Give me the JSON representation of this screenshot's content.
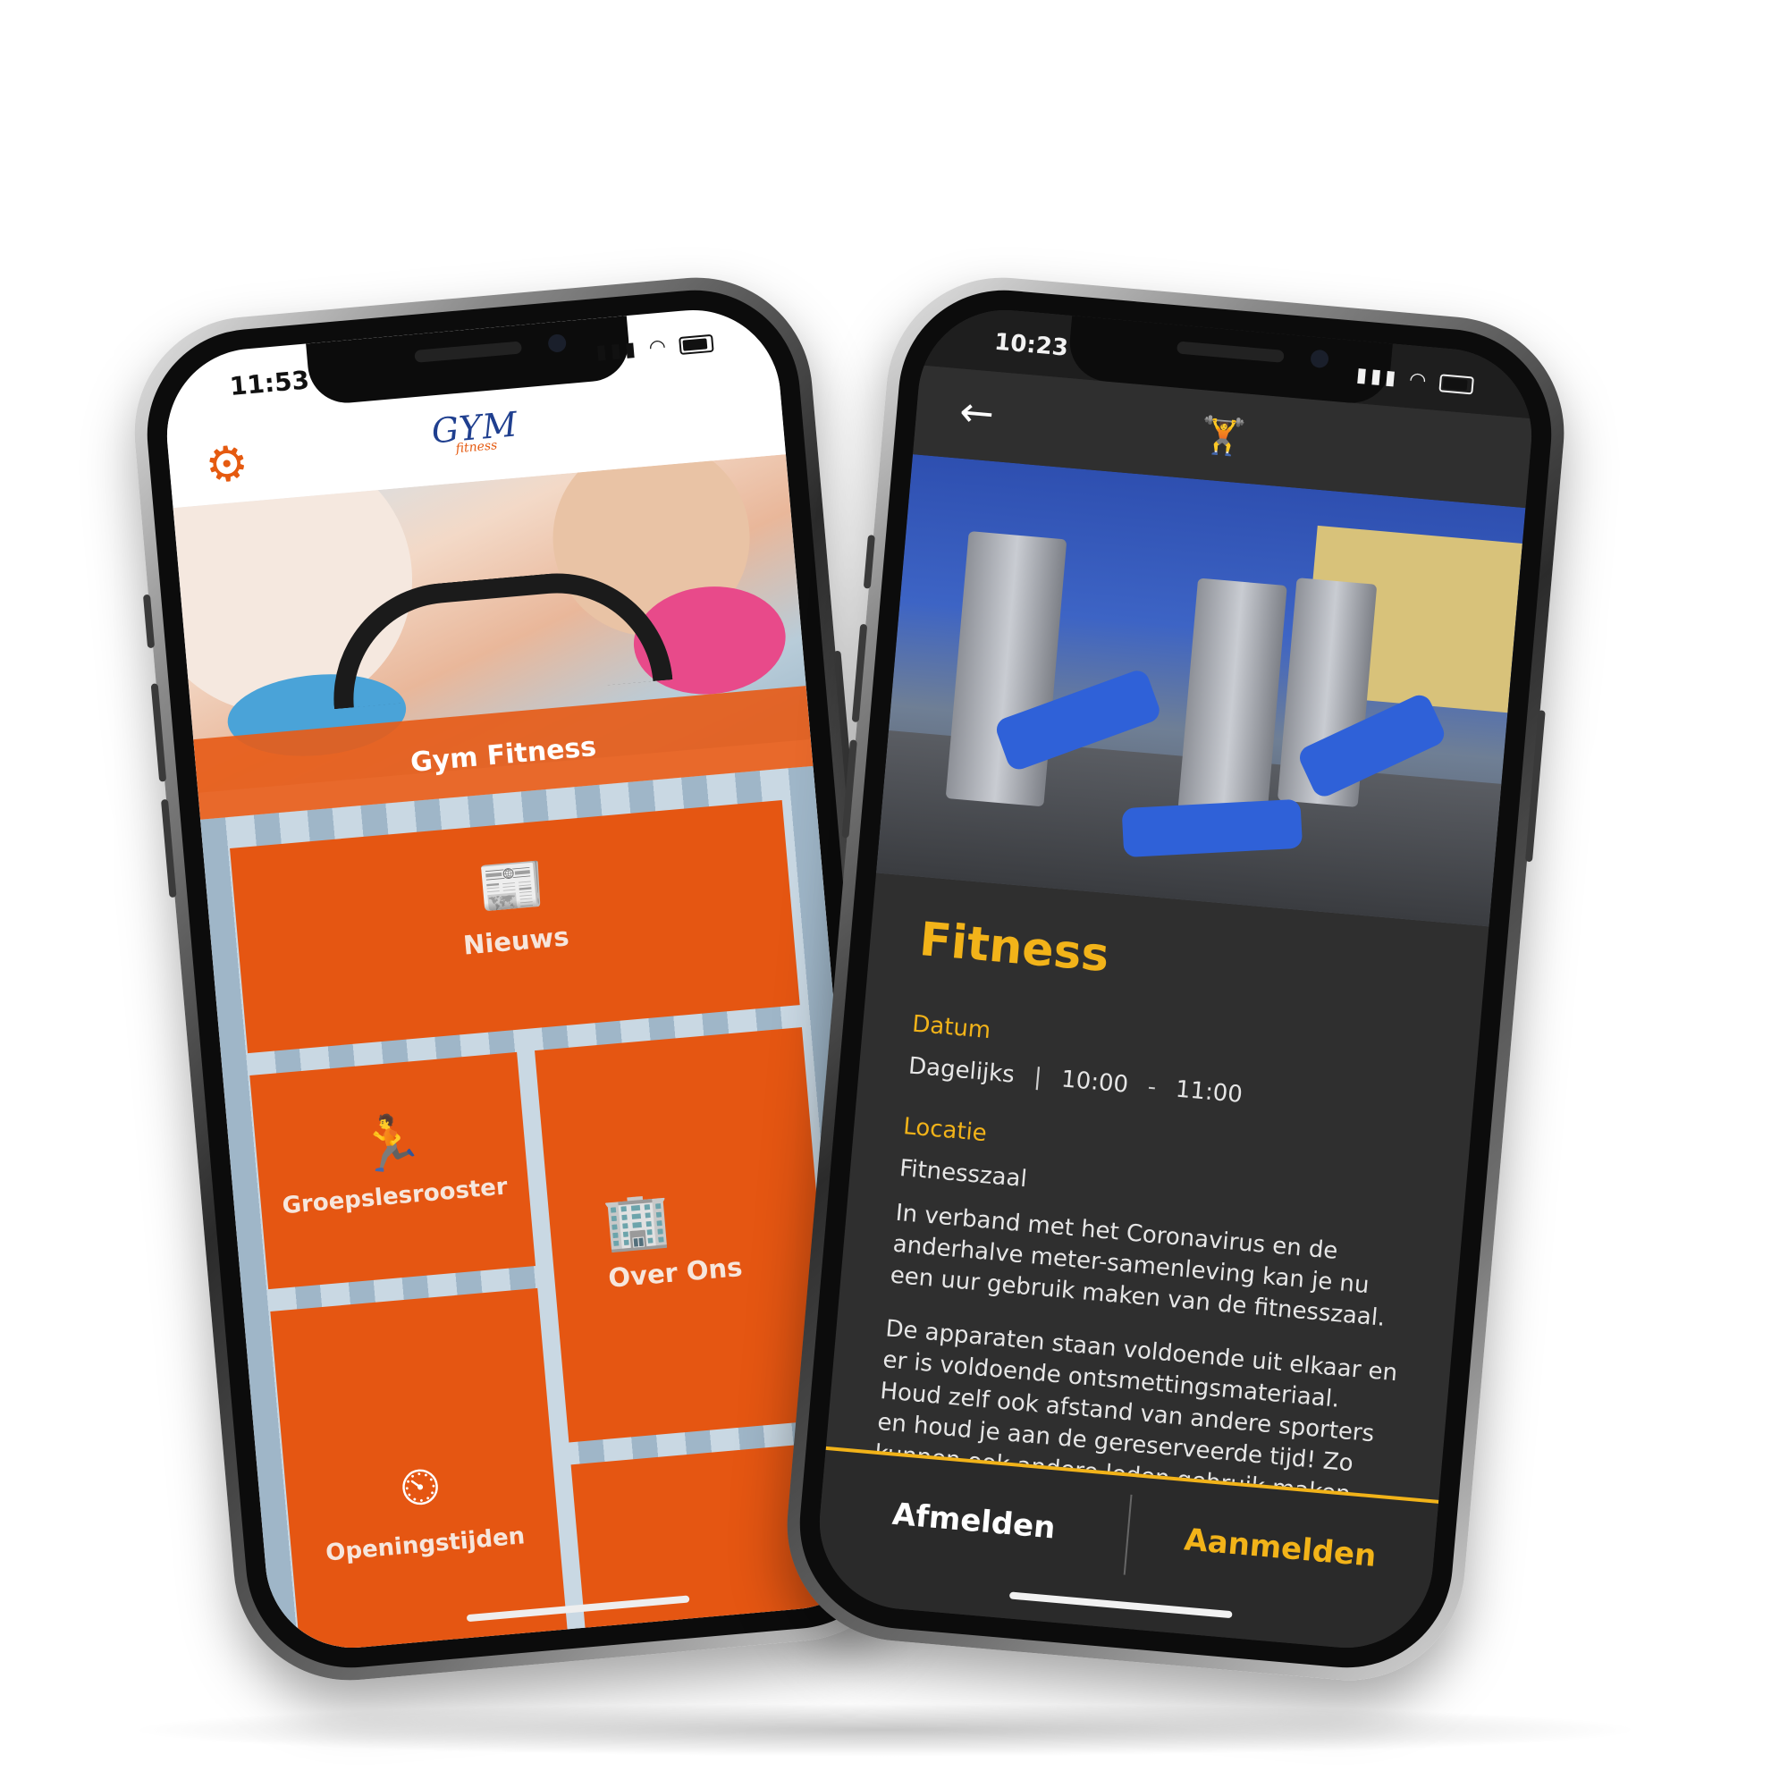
{
  "phone_left": {
    "status_time": "11:53",
    "logo_main": "GYM",
    "logo_sub": "fitness",
    "banner_title": "Gym Fitness",
    "tiles": [
      {
        "label": "Nieuws",
        "icon": "news-icon"
      },
      {
        "label": "Groepslesrooster",
        "icon": "step-aerobics-icon"
      },
      {
        "label": "Over Ons",
        "icon": "buildings-icon"
      },
      {
        "label": "Openingstijden",
        "icon": "clock-icon"
      }
    ],
    "accent": "#e55612",
    "brand_blue": "#1f3f8f"
  },
  "phone_right": {
    "status_time": "10:23",
    "title": "Fitness",
    "date_label": "Datum",
    "date_value": "Dagelijks",
    "time_start": "10:00",
    "time_end": "11:00",
    "location_label": "Locatie",
    "location_value": "Fitnesszaal",
    "paragraph_1": "In verband met het Coronavirus en de anderhalve meter-samenleving kan je nu een uur gebruik maken van de fitnesszaal.",
    "paragraph_2": "De apparaten staan voldoende uit elkaar en er is voldoende ontsmettingsmateriaal. Houd zelf ook afstand van andere sporters en houd je aan de gereserveerde tijd! Zo kunnen ook andere leden gebruik maken van de fitnesszaal.",
    "cancel_label": "Afmelden",
    "join_label": "Aanmelden",
    "accent": "#f2b319",
    "background": "#2f2f2f"
  }
}
